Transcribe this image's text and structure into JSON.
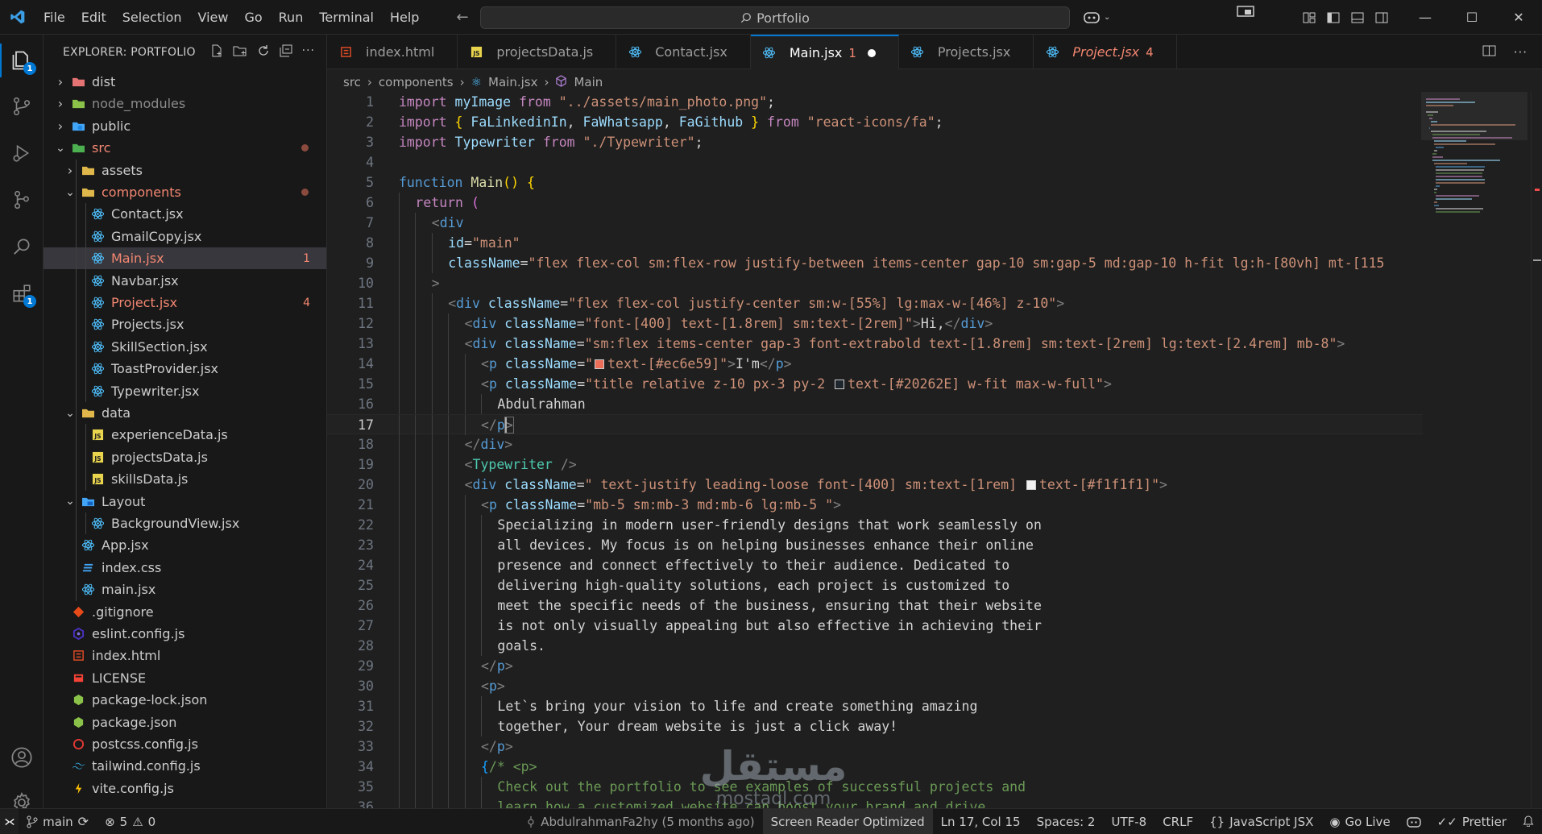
{
  "menu": [
    "File",
    "Edit",
    "Selection",
    "View",
    "Go",
    "Run",
    "Terminal",
    "Help"
  ],
  "command_center": {
    "label": "Portfolio"
  },
  "explorer": {
    "title": "EXPLORER: PORTFOLIO",
    "items": [
      {
        "name": "dist",
        "type": "folder",
        "depth": 0,
        "expanded": false,
        "icon": "folder-dist-icon"
      },
      {
        "name": "node_modules",
        "type": "folder",
        "depth": 0,
        "expanded": false,
        "icon": "folder-node-icon",
        "dim": true
      },
      {
        "name": "public",
        "type": "folder",
        "depth": 0,
        "expanded": false,
        "icon": "folder-public-icon"
      },
      {
        "name": "src",
        "type": "folder",
        "depth": 0,
        "expanded": true,
        "icon": "folder-src-icon",
        "status": "error"
      },
      {
        "name": "assets",
        "type": "folder",
        "depth": 1,
        "expanded": false,
        "icon": "folder-icon"
      },
      {
        "name": "components",
        "type": "folder",
        "depth": 1,
        "expanded": true,
        "icon": "folder-icon",
        "status": "error"
      },
      {
        "name": "Contact.jsx",
        "type": "file",
        "depth": 2,
        "icon": "react-icon"
      },
      {
        "name": "GmailCopy.jsx",
        "type": "file",
        "depth": 2,
        "icon": "react-icon"
      },
      {
        "name": "Main.jsx",
        "type": "file",
        "depth": 2,
        "icon": "react-icon",
        "selected": true,
        "status": "error",
        "badge": "1"
      },
      {
        "name": "Navbar.jsx",
        "type": "file",
        "depth": 2,
        "icon": "react-icon"
      },
      {
        "name": "Project.jsx",
        "type": "file",
        "depth": 2,
        "icon": "react-icon",
        "status": "error",
        "badge": "4"
      },
      {
        "name": "Projects.jsx",
        "type": "file",
        "depth": 2,
        "icon": "react-icon"
      },
      {
        "name": "SkillSection.jsx",
        "type": "file",
        "depth": 2,
        "icon": "react-icon"
      },
      {
        "name": "ToastProvider.jsx",
        "type": "file",
        "depth": 2,
        "icon": "react-icon"
      },
      {
        "name": "Typewriter.jsx",
        "type": "file",
        "depth": 2,
        "icon": "react-icon"
      },
      {
        "name": "data",
        "type": "folder",
        "depth": 1,
        "expanded": true,
        "icon": "folder-icon"
      },
      {
        "name": "experienceData.js",
        "type": "file",
        "depth": 2,
        "icon": "js-icon"
      },
      {
        "name": "projectsData.js",
        "type": "file",
        "depth": 2,
        "icon": "js-icon"
      },
      {
        "name": "skillsData.js",
        "type": "file",
        "depth": 2,
        "icon": "js-icon"
      },
      {
        "name": "Layout",
        "type": "folder",
        "depth": 1,
        "expanded": true,
        "icon": "folder-layout-icon"
      },
      {
        "name": "BackgroundView.jsx",
        "type": "file",
        "depth": 2,
        "icon": "react-icon"
      },
      {
        "name": "App.jsx",
        "type": "file",
        "depth": 1,
        "icon": "react-icon"
      },
      {
        "name": "index.css",
        "type": "file",
        "depth": 1,
        "icon": "css-icon"
      },
      {
        "name": "main.jsx",
        "type": "file",
        "depth": 1,
        "icon": "react-icon"
      },
      {
        "name": ".gitignore",
        "type": "file",
        "depth": 0,
        "icon": "git-icon"
      },
      {
        "name": "eslint.config.js",
        "type": "file",
        "depth": 0,
        "icon": "eslint-icon"
      },
      {
        "name": "index.html",
        "type": "file",
        "depth": 0,
        "icon": "html-icon"
      },
      {
        "name": "LICENSE",
        "type": "file",
        "depth": 0,
        "icon": "license-icon"
      },
      {
        "name": "package-lock.json",
        "type": "file",
        "depth": 0,
        "icon": "node-icon"
      },
      {
        "name": "package.json",
        "type": "file",
        "depth": 0,
        "icon": "node-icon"
      },
      {
        "name": "postcss.config.js",
        "type": "file",
        "depth": 0,
        "icon": "postcss-icon"
      },
      {
        "name": "tailwind.config.js",
        "type": "file",
        "depth": 0,
        "icon": "tailwind-icon"
      },
      {
        "name": "vite.config.js",
        "type": "file",
        "depth": 0,
        "icon": "vite-icon"
      }
    ]
  },
  "tabs": [
    {
      "label": "index.html",
      "icon": "html-icon"
    },
    {
      "label": "projectsData.js",
      "icon": "js-icon"
    },
    {
      "label": "Contact.jsx",
      "icon": "react-icon"
    },
    {
      "label": "Main.jsx",
      "icon": "react-icon",
      "active": true,
      "count": "1",
      "dirty": true
    },
    {
      "label": "Projects.jsx",
      "icon": "react-icon"
    },
    {
      "label": "Project.jsx",
      "icon": "react-icon",
      "error": true,
      "count": "4"
    }
  ],
  "breadcrumb": {
    "src": "src",
    "components": "components",
    "file": "Main.jsx",
    "symbol": "Main"
  },
  "editor": {
    "current_line": 17,
    "lines": [
      {
        "n": "1",
        "indent": 0,
        "tokens": [
          [
            "imp",
            "import"
          ],
          [
            "t",
            " "
          ],
          [
            "id",
            "myImage"
          ],
          [
            "t",
            " "
          ],
          [
            "imp",
            "from"
          ],
          [
            "t",
            " "
          ],
          [
            "str",
            "\"../assets/main_photo.png\""
          ],
          [
            "t",
            ";"
          ]
        ]
      },
      {
        "n": "2",
        "indent": 0,
        "tokens": [
          [
            "imp",
            "import"
          ],
          [
            "t",
            " "
          ],
          [
            "br1",
            "{"
          ],
          [
            "t",
            " "
          ],
          [
            "id",
            "FaLinkedinIn"
          ],
          [
            "t",
            ", "
          ],
          [
            "id",
            "FaWhatsapp"
          ],
          [
            "t",
            ", "
          ],
          [
            "id",
            "FaGithub"
          ],
          [
            "t",
            " "
          ],
          [
            "br1",
            "}"
          ],
          [
            "t",
            " "
          ],
          [
            "imp",
            "from"
          ],
          [
            "t",
            " "
          ],
          [
            "str",
            "\"react-icons/fa\""
          ],
          [
            "t",
            ";"
          ]
        ]
      },
      {
        "n": "3",
        "indent": 0,
        "tokens": [
          [
            "imp",
            "import"
          ],
          [
            "t",
            " "
          ],
          [
            "id",
            "Typewriter"
          ],
          [
            "t",
            " "
          ],
          [
            "imp",
            "from"
          ],
          [
            "t",
            " "
          ],
          [
            "str",
            "\"./Typewriter\""
          ],
          [
            "t",
            ";"
          ]
        ]
      },
      {
        "n": "4",
        "indent": 0,
        "tokens": []
      },
      {
        "n": "5",
        "indent": 0,
        "tokens": [
          [
            "fn",
            "function"
          ],
          [
            "t",
            " "
          ],
          [
            "func",
            "Main"
          ],
          [
            "br1",
            "()"
          ],
          [
            "t",
            " "
          ],
          [
            "br1",
            "{"
          ]
        ]
      },
      {
        "n": "6",
        "indent": 1,
        "tokens": [
          [
            "imp",
            "return"
          ],
          [
            "t",
            " "
          ],
          [
            "br2",
            "("
          ]
        ]
      },
      {
        "n": "7",
        "indent": 2,
        "tokens": [
          [
            "punct",
            "<"
          ],
          [
            "tag",
            "div"
          ]
        ]
      },
      {
        "n": "8",
        "indent": 3,
        "tokens": [
          [
            "attr",
            "id"
          ],
          [
            "t",
            "="
          ],
          [
            "str",
            "\"main\""
          ]
        ]
      },
      {
        "n": "9",
        "indent": 3,
        "tokens": [
          [
            "attr",
            "className"
          ],
          [
            "t",
            "="
          ],
          [
            "str",
            "\"flex flex-col sm:flex-row justify-between items-center gap-10 sm:gap-5 md:gap-10 h-fit lg:h-[80vh] mt-[115"
          ]
        ]
      },
      {
        "n": "10",
        "indent": 2,
        "tokens": [
          [
            "punct",
            ">"
          ]
        ]
      },
      {
        "n": "11",
        "indent": 3,
        "tokens": [
          [
            "punct",
            "<"
          ],
          [
            "tag",
            "div"
          ],
          [
            "t",
            " "
          ],
          [
            "attr",
            "className"
          ],
          [
            "t",
            "="
          ],
          [
            "str",
            "\"flex flex-col justify-center sm:w-[55%] lg:max-w-[46%] z-10\""
          ],
          [
            "punct",
            ">"
          ]
        ]
      },
      {
        "n": "12",
        "indent": 4,
        "tokens": [
          [
            "punct",
            "<"
          ],
          [
            "tag",
            "div"
          ],
          [
            "t",
            " "
          ],
          [
            "attr",
            "className"
          ],
          [
            "t",
            "="
          ],
          [
            "str",
            "\"font-[400] text-[1.8rem] sm:text-[2rem]\""
          ],
          [
            "punct",
            ">"
          ],
          [
            "t",
            "Hi,"
          ],
          [
            "punct",
            "</"
          ],
          [
            "tag",
            "div"
          ],
          [
            "punct",
            ">"
          ]
        ]
      },
      {
        "n": "13",
        "indent": 4,
        "tokens": [
          [
            "punct",
            "<"
          ],
          [
            "tag",
            "div"
          ],
          [
            "t",
            " "
          ],
          [
            "attr",
            "className"
          ],
          [
            "t",
            "="
          ],
          [
            "str",
            "\"sm:flex items-center gap-3 font-extrabold text-[1.8rem] sm:text-[2rem] lg:text-[2.4rem] mb-8\""
          ],
          [
            "punct",
            ">"
          ]
        ]
      },
      {
        "n": "14",
        "indent": 5,
        "tokens": [
          [
            "punct",
            "<"
          ],
          [
            "tag",
            "p"
          ],
          [
            "t",
            " "
          ],
          [
            "attr",
            "className"
          ],
          [
            "t",
            "="
          ],
          [
            "str",
            "\""
          ],
          [
            "swatch",
            "#ec6e59"
          ],
          [
            "str",
            "text-[#ec6e59]\""
          ],
          [
            "punct",
            ">"
          ],
          [
            "t",
            "I'm"
          ],
          [
            "punct",
            "</"
          ],
          [
            "tag",
            "p"
          ],
          [
            "punct",
            ">"
          ]
        ]
      },
      {
        "n": "15",
        "indent": 5,
        "tokens": [
          [
            "punct",
            "<"
          ],
          [
            "tag",
            "p"
          ],
          [
            "t",
            " "
          ],
          [
            "attr",
            "className"
          ],
          [
            "t",
            "="
          ],
          [
            "str",
            "\"title relative z-10 px-3 py-2 "
          ],
          [
            "swatch",
            "#20262E"
          ],
          [
            "str",
            "text-[#20262E] w-fit max-w-full\""
          ],
          [
            "punct",
            ">"
          ]
        ]
      },
      {
        "n": "16",
        "indent": 6,
        "tokens": [
          [
            "t",
            "Abdulrahman"
          ]
        ]
      },
      {
        "n": "17",
        "indent": 5,
        "tokens": [
          [
            "punct",
            "</"
          ],
          [
            "tag",
            "p"
          ],
          [
            "cursorpunct",
            ">"
          ]
        ]
      },
      {
        "n": "18",
        "indent": 4,
        "tokens": [
          [
            "punct",
            "</"
          ],
          [
            "tag",
            "div"
          ],
          [
            "punct",
            ">"
          ]
        ]
      },
      {
        "n": "19",
        "indent": 4,
        "tokens": [
          [
            "punct",
            "<"
          ],
          [
            "comp",
            "Typewriter"
          ],
          [
            "t",
            " "
          ],
          [
            "punct",
            "/>"
          ]
        ]
      },
      {
        "n": "20",
        "indent": 4,
        "tokens": [
          [
            "punct",
            "<"
          ],
          [
            "tag",
            "div"
          ],
          [
            "t",
            " "
          ],
          [
            "attr",
            "className"
          ],
          [
            "t",
            "="
          ],
          [
            "str",
            "\" text-justify leading-loose font-[400] sm:text-[1rem] "
          ],
          [
            "swatch",
            "#f1f1f1"
          ],
          [
            "str",
            "text-[#f1f1f1]\""
          ],
          [
            "punct",
            ">"
          ]
        ]
      },
      {
        "n": "21",
        "indent": 5,
        "tokens": [
          [
            "punct",
            "<"
          ],
          [
            "tag",
            "p"
          ],
          [
            "t",
            " "
          ],
          [
            "attr",
            "className"
          ],
          [
            "t",
            "="
          ],
          [
            "str",
            "\"mb-5 sm:mb-3 md:mb-6 lg:mb-5 \""
          ],
          [
            "punct",
            ">"
          ]
        ]
      },
      {
        "n": "22",
        "indent": 6,
        "tokens": [
          [
            "t",
            "Specializing in modern user-friendly designs that work seamlessly on"
          ]
        ]
      },
      {
        "n": "23",
        "indent": 6,
        "tokens": [
          [
            "t",
            "all devices. My focus is on helping businesses enhance their online"
          ]
        ]
      },
      {
        "n": "24",
        "indent": 6,
        "tokens": [
          [
            "t",
            "presence and connect effectively to their audience. Dedicated to"
          ]
        ]
      },
      {
        "n": "25",
        "indent": 6,
        "tokens": [
          [
            "t",
            "delivering high-quality solutions, each project is customized to"
          ]
        ]
      },
      {
        "n": "26",
        "indent": 6,
        "tokens": [
          [
            "t",
            "meet the specific needs of the business, ensuring that their website"
          ]
        ]
      },
      {
        "n": "27",
        "indent": 6,
        "tokens": [
          [
            "t",
            "is not only visually appealing but also effective in achieving their"
          ]
        ]
      },
      {
        "n": "28",
        "indent": 6,
        "tokens": [
          [
            "t",
            "goals."
          ]
        ]
      },
      {
        "n": "29",
        "indent": 5,
        "tokens": [
          [
            "punct",
            "</"
          ],
          [
            "tag",
            "p"
          ],
          [
            "punct",
            ">"
          ]
        ]
      },
      {
        "n": "30",
        "indent": 5,
        "tokens": [
          [
            "punct",
            "<"
          ],
          [
            "tag",
            "p"
          ],
          [
            "punct",
            ">"
          ]
        ]
      },
      {
        "n": "31",
        "indent": 6,
        "tokens": [
          [
            "t",
            "Let`s bring your vision to life and create something amazing"
          ]
        ]
      },
      {
        "n": "32",
        "indent": 6,
        "tokens": [
          [
            "t",
            "together, Your dream website is just a click away!"
          ]
        ]
      },
      {
        "n": "33",
        "indent": 5,
        "tokens": [
          [
            "punct",
            "</"
          ],
          [
            "tag",
            "p"
          ],
          [
            "punct",
            ">"
          ]
        ]
      },
      {
        "n": "34",
        "indent": 5,
        "tokens": [
          [
            "br3",
            "{"
          ],
          [
            "comment",
            "/* <p>"
          ]
        ]
      },
      {
        "n": "35",
        "indent": 6,
        "tokens": [
          [
            "comment",
            "Check out the portfolio to see examples of successful projects and"
          ]
        ]
      },
      {
        "n": "36",
        "indent": 6,
        "tokens": [
          [
            "comment",
            "learn how a customized website can boost your brand and drive"
          ]
        ]
      }
    ]
  },
  "status": {
    "branch": "main",
    "errors": "5",
    "warnings": "0",
    "blame": "AbdulrahmanFa2hy (5 months ago)",
    "screen_reader": "Screen Reader Optimized",
    "position": "Ln 17, Col 15",
    "spaces": "Spaces: 2",
    "encoding": "UTF-8",
    "eol": "CRLF",
    "language": "JavaScript JSX",
    "golive": "Go Live",
    "prettier": "Prettier"
  },
  "activity_badges": {
    "explorer": "1",
    "extensions": "1"
  },
  "watermark": {
    "text_ar": "مستقل",
    "text_en": "mostaql.com"
  },
  "colors": {
    "accent": "#0078d4",
    "error": "#f48771",
    "modified_dot": "#8a4b3e"
  }
}
